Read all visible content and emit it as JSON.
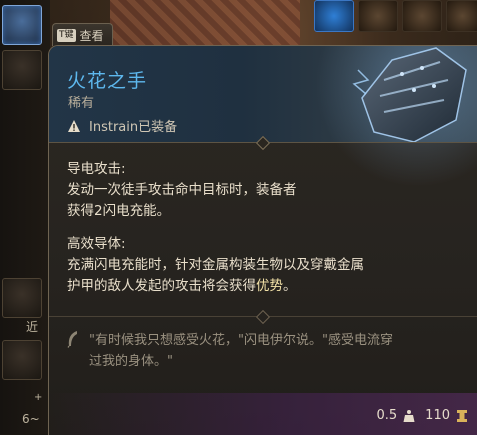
{
  "item": {
    "name": "火花之手",
    "rarity": "稀有",
    "equipped_by": "Instrain已装备"
  },
  "inspect": {
    "key": "T键",
    "label": "查看"
  },
  "abilities": [
    {
      "title": "导电攻击:",
      "lines": [
        "发动一次徒手攻击命中目标时，装备者",
        "获得2闪电充能。"
      ]
    },
    {
      "title": "高效导体:",
      "lines": [
        "充满闪电充能时，针对金属构装生物以及穿戴金属",
        "护甲的敌人发起的攻击将会获得"
      ],
      "highlight": "优势",
      "tail": "。"
    }
  ],
  "flavor": {
    "line1": "\"有时候我只想感受火花，\"闪电伊尔说。\"感受电流穿",
    "line2": "过我的身体。\""
  },
  "stats": {
    "weight": "0.5",
    "value": "110"
  },
  "background": {
    "left_text_1": "近",
    "left_text_2": "+",
    "left_text_3": "6~"
  },
  "colors": {
    "item_name": "#5eb8ee",
    "highlight": "#f3e2a8"
  },
  "icons": [
    "warning-icon",
    "quill-icon",
    "weight-icon",
    "gold-icon",
    "gauntlet-icon"
  ]
}
